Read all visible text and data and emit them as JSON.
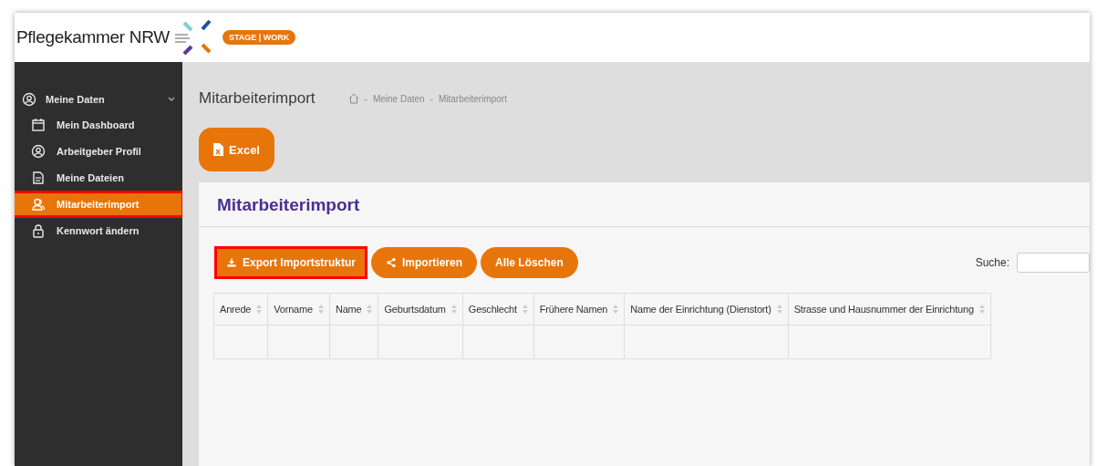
{
  "header": {
    "logo_text": "Pflegekammer NRW",
    "badge": "STAGE | WORK"
  },
  "sidebar": {
    "group": {
      "label": "Meine Daten",
      "expanded": true
    },
    "items": [
      {
        "label": "Mein Dashboard",
        "kind": "calendar",
        "selected": false,
        "highlighted": false
      },
      {
        "label": "Arbeitgeber Profil",
        "kind": "user-circle",
        "selected": false,
        "highlighted": false
      },
      {
        "label": "Meine Dateien",
        "kind": "file-edit",
        "selected": false,
        "highlighted": false
      },
      {
        "label": "Mitarbeiterimport",
        "kind": "users",
        "selected": true,
        "highlighted": true
      },
      {
        "label": "Kennwort ändern",
        "kind": "lock",
        "selected": false,
        "highlighted": false
      }
    ]
  },
  "page": {
    "title": "Mitarbeiterimport",
    "breadcrumb": [
      {
        "separator": "-",
        "label": "Meine Daten"
      },
      {
        "separator": "-",
        "label": "Mitarbeiterimport"
      }
    ],
    "excel_button": "Excel"
  },
  "card": {
    "title": "Mitarbeiterimport",
    "buttons": [
      {
        "label": "Export Importstruktur",
        "kind": "download",
        "highlighted": true
      },
      {
        "label": "Importieren",
        "kind": "share",
        "highlighted": false
      },
      {
        "label": "Alle Löschen",
        "kind": "plain",
        "highlighted": false
      }
    ],
    "search": {
      "label": "Suche:"
    },
    "table": {
      "columns": [
        "Anrede",
        "Vorname",
        "Name",
        "Geburtsdatum",
        "Geschlecht",
        "Frühere Namen",
        "Name der Einrichtung (Dienstort)",
        "Strasse und Hausnummer der Einrichtung"
      ]
    }
  }
}
